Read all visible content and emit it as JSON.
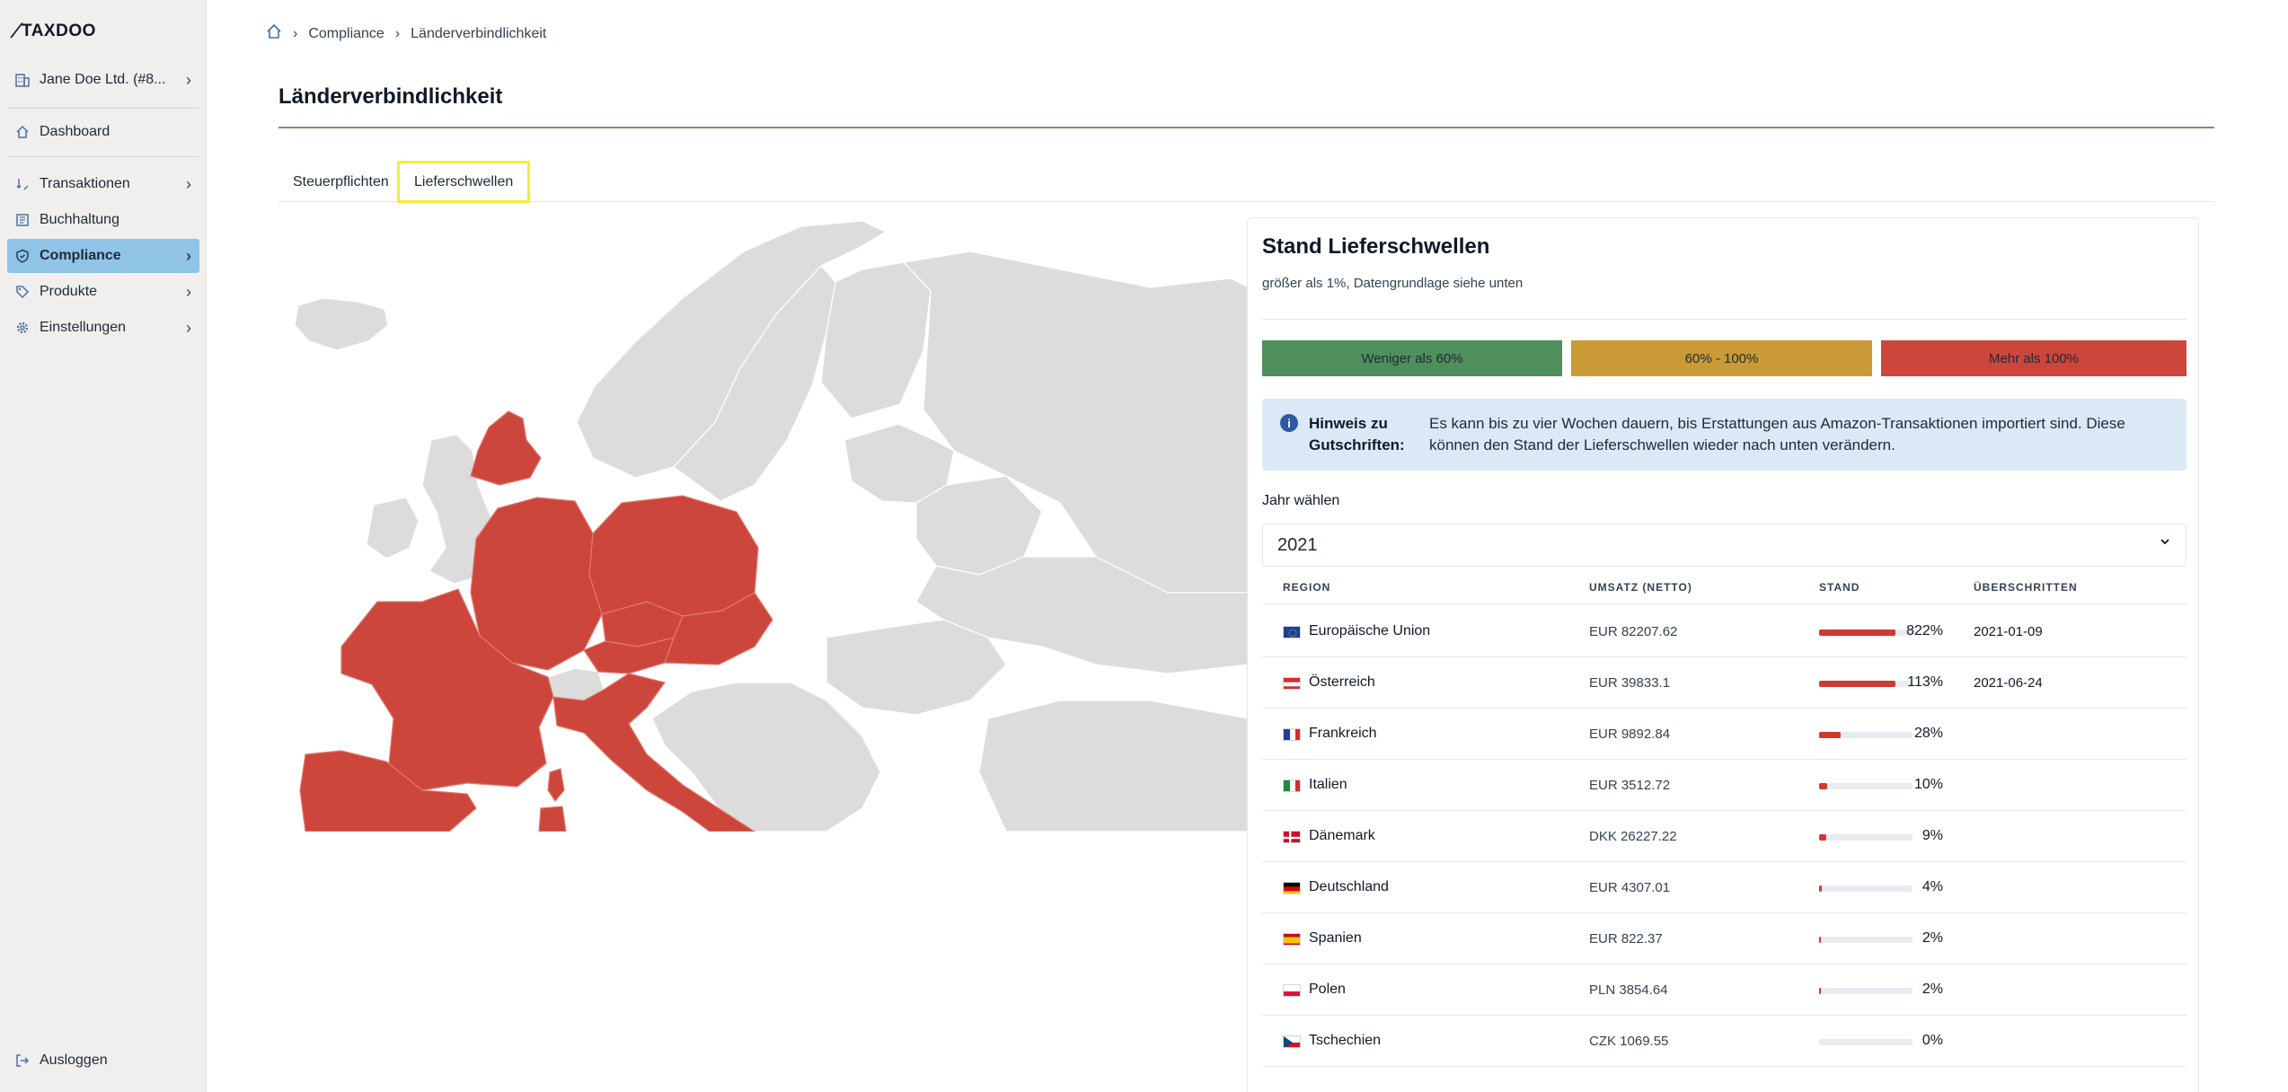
{
  "app": {
    "logo_text": "TAXDOO"
  },
  "sidebar": {
    "company": "Jane Doe Ltd. (#8...",
    "items": [
      {
        "label": "Dashboard"
      },
      {
        "label": "Transaktionen"
      },
      {
        "label": "Buchhaltung"
      },
      {
        "label": "Compliance"
      },
      {
        "label": "Produkte"
      },
      {
        "label": "Einstellungen"
      }
    ],
    "logout": "Ausloggen"
  },
  "breadcrumb": {
    "items": [
      "Compliance",
      "Länderverbindlichkeit"
    ]
  },
  "page": {
    "title": "Länderverbindlichkeit",
    "tabs": [
      {
        "label": "Steuerpflichten",
        "active": false
      },
      {
        "label": "Lieferschwellen",
        "active": true
      }
    ]
  },
  "card": {
    "title": "Stand Lieferschwellen",
    "subtitle": "größer als 1%, Datengrundlage siehe unten",
    "legend": [
      {
        "label": "Weniger als 60%",
        "color": "#4f8f5b"
      },
      {
        "label": "60% - 100%",
        "color": "#c99a35"
      },
      {
        "label": "Mehr als 100%",
        "color": "#cc463c"
      }
    ],
    "hint_title": "Hinweis zu Gutschriften:",
    "hint_text": "Es kann bis zu vier Wochen dauern, bis Erstattungen aus Amazon-Transaktionen importiert sind. Diese können den Stand der Lieferschwellen wieder nach unten verändern.",
    "year_label": "Jahr wählen",
    "year_value": "2021",
    "columns": [
      "REGION",
      "UMSATZ (NETTO)",
      "STAND",
      "ÜBERSCHRITTEN"
    ],
    "rows": [
      {
        "region": "Europäische Union",
        "flag": "eu",
        "amount": "EUR 82207.62",
        "stand": "822%",
        "stand_value": 822,
        "exceeded": "2021-01-09"
      },
      {
        "region": "Österreich",
        "flag": "at",
        "amount": "EUR 39833.1",
        "stand": "113%",
        "stand_value": 113,
        "exceeded": "2021-06-24"
      },
      {
        "region": "Frankreich",
        "flag": "fr",
        "amount": "EUR 9892.84",
        "stand": "28%",
        "stand_value": 28,
        "exceeded": ""
      },
      {
        "region": "Italien",
        "flag": "it",
        "amount": "EUR 3512.72",
        "stand": "10%",
        "stand_value": 10,
        "exceeded": ""
      },
      {
        "region": "Dänemark",
        "flag": "dk",
        "amount": "DKK 26227.22",
        "stand": "9%",
        "stand_value": 9,
        "exceeded": ""
      },
      {
        "region": "Deutschland",
        "flag": "de",
        "amount": "EUR 4307.01",
        "stand": "4%",
        "stand_value": 4,
        "exceeded": ""
      },
      {
        "region": "Spanien",
        "flag": "es",
        "amount": "EUR 822.37",
        "stand": "2%",
        "stand_value": 2,
        "exceeded": ""
      },
      {
        "region": "Polen",
        "flag": "pl",
        "amount": "PLN 3854.64",
        "stand": "2%",
        "stand_value": 2,
        "exceeded": ""
      },
      {
        "region": "Tschechien",
        "flag": "cz",
        "amount": "CZK 1069.55",
        "stand": "0%",
        "stand_value": 0,
        "exceeded": ""
      }
    ]
  },
  "colors": {
    "exceeded_country": "#cc463c",
    "other_country": "#dcdcdc",
    "sidebar_active": "#8fc4e6"
  }
}
